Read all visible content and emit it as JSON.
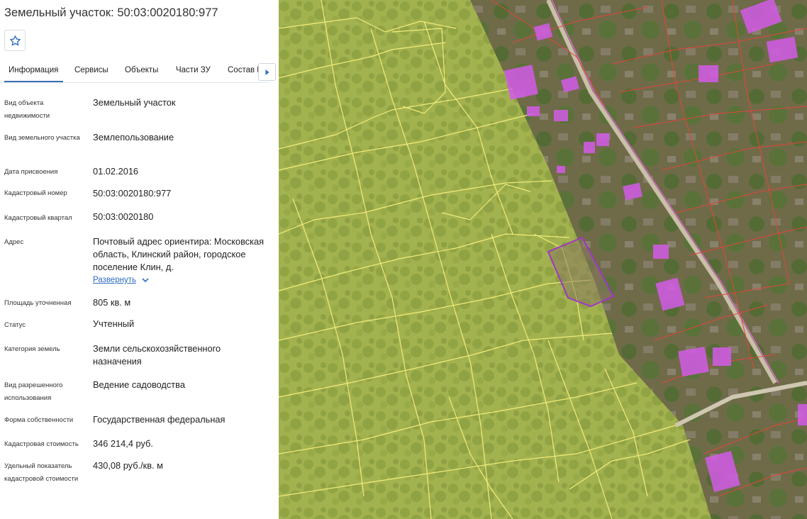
{
  "title": "Земельный участок: 50:03:0020180:977",
  "tabs": [
    "Информация",
    "Сервисы",
    "Объекты",
    "Части ЗУ",
    "Состав ЕЗП"
  ],
  "expand_label": "Развернуть",
  "icons": {
    "favorite": "star-icon",
    "next": "chevron-right-icon",
    "expand": "chevron-down-icon"
  },
  "colors": {
    "accent": "#3a6db5",
    "link": "#2f6cc0",
    "parcel_border": "#f2ec7a",
    "building_fill": "#d45be8",
    "selected_parcel": "#a035c8"
  },
  "fields": [
    {
      "label": "Вид объекта недвижимости",
      "value": "Земельный участок"
    },
    {
      "label": "Вид земельного участка",
      "value": "Землепользование"
    },
    {
      "label": "Дата присвоения",
      "value": "01.02.2016"
    },
    {
      "label": "Кадастровый номер",
      "value": "50:03:0020180:977"
    },
    {
      "label": "Кадастровый квартал",
      "value": "50:03:0020180"
    },
    {
      "label": "Адрес",
      "value": "Почтовый адрес ориентира: Московская область, Клинский район, городское поселение Клин, д."
    },
    {
      "label": "Площадь уточненная",
      "value": "805 кв. м"
    },
    {
      "label": "Статус",
      "value": "Учтенный"
    },
    {
      "label": "Категория земель",
      "value": "Земли сельскохозяйственного назначения"
    },
    {
      "label": "Вид разрешенного использования",
      "value": "Ведение садоводства"
    },
    {
      "label": "Форма собственности",
      "value": "Государственная федеральная"
    },
    {
      "label": "Кадастровая стоимость",
      "value": "346 214,4 руб."
    },
    {
      "label": "Удельный показатель кадастровой стоимости",
      "value": "430,08 руб./кв. м"
    }
  ]
}
